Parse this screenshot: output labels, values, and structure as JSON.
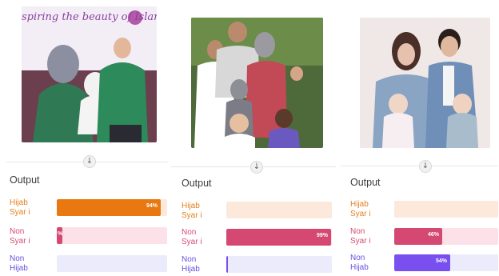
{
  "output_title": "Output",
  "arrow_icon": "arrow-down-icon",
  "classes": [
    {
      "label": "Hijab\nSyar i",
      "text_color": "#e2801c",
      "track_color": "#fde9dc",
      "bar_color": "#e8780f"
    },
    {
      "label": "Non\nSyar i",
      "text_color": "#d94a72",
      "track_color": "#fce1e8",
      "bar_color": "#d44872"
    },
    {
      "label": "Non\nHijab",
      "text_color": "#6a4fe0",
      "track_color": "#ecebfc",
      "bar_color": "#7a4ff0"
    }
  ],
  "panels": [
    {
      "photo_caption": "spiring the beauty of Islam",
      "results": [
        {
          "value": 0.94,
          "pct_text": "94%"
        },
        {
          "value": 0.05,
          "pct_text": "%"
        },
        {
          "value": 0.0,
          "pct_text": ""
        }
      ]
    },
    {
      "photo_caption": "",
      "results": [
        {
          "value": 0.0,
          "pct_text": ""
        },
        {
          "value": 0.99,
          "pct_text": "99%"
        },
        {
          "value": 0.01,
          "pct_text": ""
        }
      ]
    },
    {
      "photo_caption": "",
      "results": [
        {
          "value": 0.0,
          "pct_text": ""
        },
        {
          "value": 0.46,
          "pct_text": "46%"
        },
        {
          "value": 0.54,
          "pct_text": "54%"
        }
      ]
    }
  ]
}
